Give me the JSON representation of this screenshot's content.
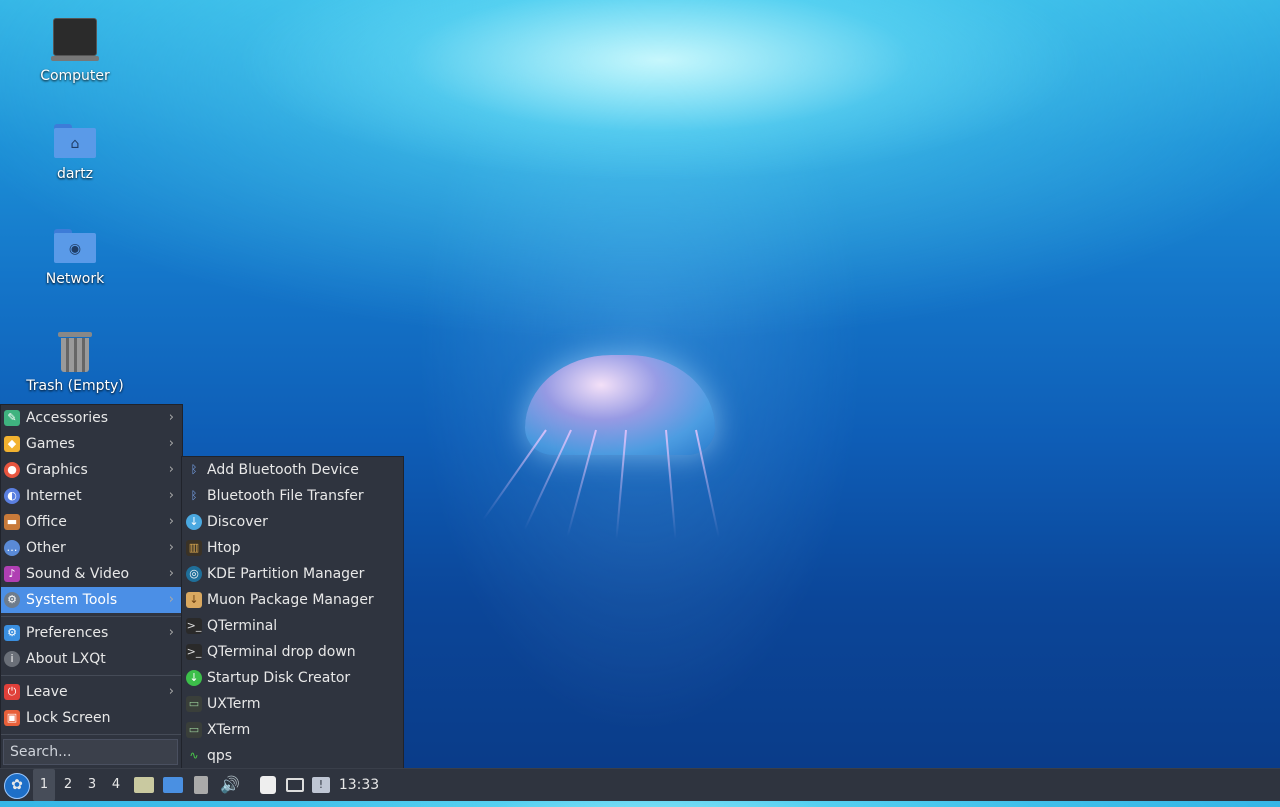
{
  "desktop": {
    "icons": [
      {
        "label": "Computer",
        "icon": "computer-icon"
      },
      {
        "label": "dartz",
        "icon": "home-folder-icon"
      },
      {
        "label": "Network",
        "icon": "network-folder-icon"
      },
      {
        "label": "Trash (Empty)",
        "icon": "trash-icon"
      }
    ]
  },
  "main_menu": {
    "items": [
      {
        "label": "Accessories",
        "icon": "accessories-icon",
        "color": "#3fb37f",
        "submenu": true
      },
      {
        "label": "Games",
        "icon": "games-icon",
        "color": "#f2b230",
        "submenu": true
      },
      {
        "label": "Graphics",
        "icon": "graphics-icon",
        "color": "#e8553f",
        "submenu": true
      },
      {
        "label": "Internet",
        "icon": "internet-icon",
        "color": "#5a7fe0",
        "submenu": true
      },
      {
        "label": "Office",
        "icon": "office-icon",
        "color": "#c87a3a",
        "submenu": true
      },
      {
        "label": "Other",
        "icon": "other-icon",
        "color": "#5a8ad6",
        "submenu": true
      },
      {
        "label": "Sound & Video",
        "icon": "sound-video-icon",
        "color": "#b03fb3",
        "submenu": true
      },
      {
        "label": "System Tools",
        "icon": "system-tools-icon",
        "color": "#6e7c8c",
        "submenu": true,
        "active": true
      },
      {
        "label": "Preferences",
        "icon": "preferences-icon",
        "color": "#3a8fe0",
        "submenu": true
      },
      {
        "label": "About LXQt",
        "icon": "info-icon",
        "color": "#6a6f78",
        "submenu": false
      },
      {
        "label": "Leave",
        "icon": "power-icon",
        "color": "#e0403a",
        "submenu": true
      },
      {
        "label": "Lock Screen",
        "icon": "lock-icon",
        "color": "#e8603a",
        "submenu": false
      }
    ],
    "search_placeholder": "Search..."
  },
  "system_tools_menu": {
    "items": [
      {
        "label": "Add Bluetooth Device",
        "icon": "bluetooth-icon"
      },
      {
        "label": "Bluetooth File Transfer",
        "icon": "bluetooth-icon"
      },
      {
        "label": "Discover",
        "icon": "discover-icon"
      },
      {
        "label": "Htop",
        "icon": "htop-icon"
      },
      {
        "label": "KDE Partition Manager",
        "icon": "partition-manager-icon"
      },
      {
        "label": "Muon Package Manager",
        "icon": "package-manager-icon"
      },
      {
        "label": "QTerminal",
        "icon": "terminal-icon"
      },
      {
        "label": "QTerminal drop down",
        "icon": "terminal-icon"
      },
      {
        "label": "Startup Disk Creator",
        "icon": "usb-creator-icon"
      },
      {
        "label": "UXTerm",
        "icon": "xterm-icon"
      },
      {
        "label": "XTerm",
        "icon": "xterm-icon"
      },
      {
        "label": "qps",
        "icon": "qps-icon"
      }
    ]
  },
  "taskbar": {
    "desktops": [
      "1",
      "2",
      "3",
      "4"
    ],
    "active_desktop": "1",
    "clock": "13:33"
  }
}
